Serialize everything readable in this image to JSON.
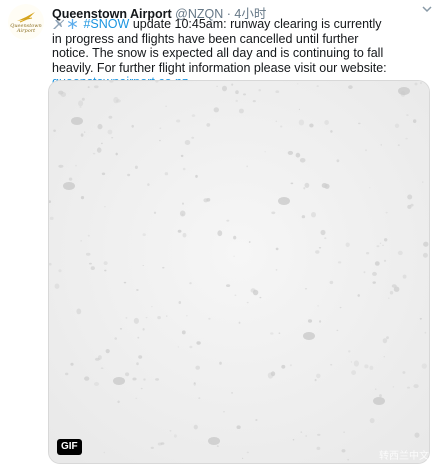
{
  "account": {
    "avatar_text": "Queenstown Airport",
    "name": "Queenstown Airport",
    "handle": "@NZQN",
    "separator": "·",
    "time": "4小时"
  },
  "tweet": {
    "hashtag": "#SNOW",
    "text": "update 10:45am: runway clearing is currently in progress and flights have been cancelled until further notice. The snow is expected all day and is continuing to fall heavily. For further flight information please visit our website:",
    "link": "queenstownairport.co.nz",
    "emoji": [
      "airplane-emoji",
      "snowflake-emoji"
    ]
  },
  "media": {
    "badge": "GIF",
    "watermark": "转西兰中文生",
    "icon": "snowfall-image"
  },
  "colors": {
    "link": "#1b95e0",
    "muted": "#657786",
    "background": "#ffffff",
    "media_bg": "#f2f2f2"
  }
}
